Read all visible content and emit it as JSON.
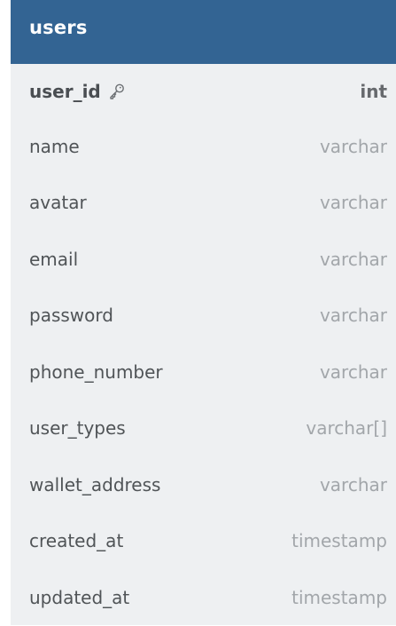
{
  "table": {
    "name": "users",
    "header_color": "#336493",
    "fields": [
      {
        "name": "user_id",
        "type": "int",
        "primary_key": true
      },
      {
        "name": "name",
        "type": "varchar",
        "primary_key": false
      },
      {
        "name": "avatar",
        "type": "varchar",
        "primary_key": false
      },
      {
        "name": "email",
        "type": "varchar",
        "primary_key": false
      },
      {
        "name": "password",
        "type": "varchar",
        "primary_key": false
      },
      {
        "name": "phone_number",
        "type": "varchar",
        "primary_key": false
      },
      {
        "name": "user_types",
        "type": "varchar[]",
        "primary_key": false
      },
      {
        "name": "wallet_address",
        "type": "varchar",
        "primary_key": false
      },
      {
        "name": "created_at",
        "type": "timestamp",
        "primary_key": false
      },
      {
        "name": "updated_at",
        "type": "timestamp",
        "primary_key": false
      }
    ],
    "key_icon": "key-icon"
  }
}
